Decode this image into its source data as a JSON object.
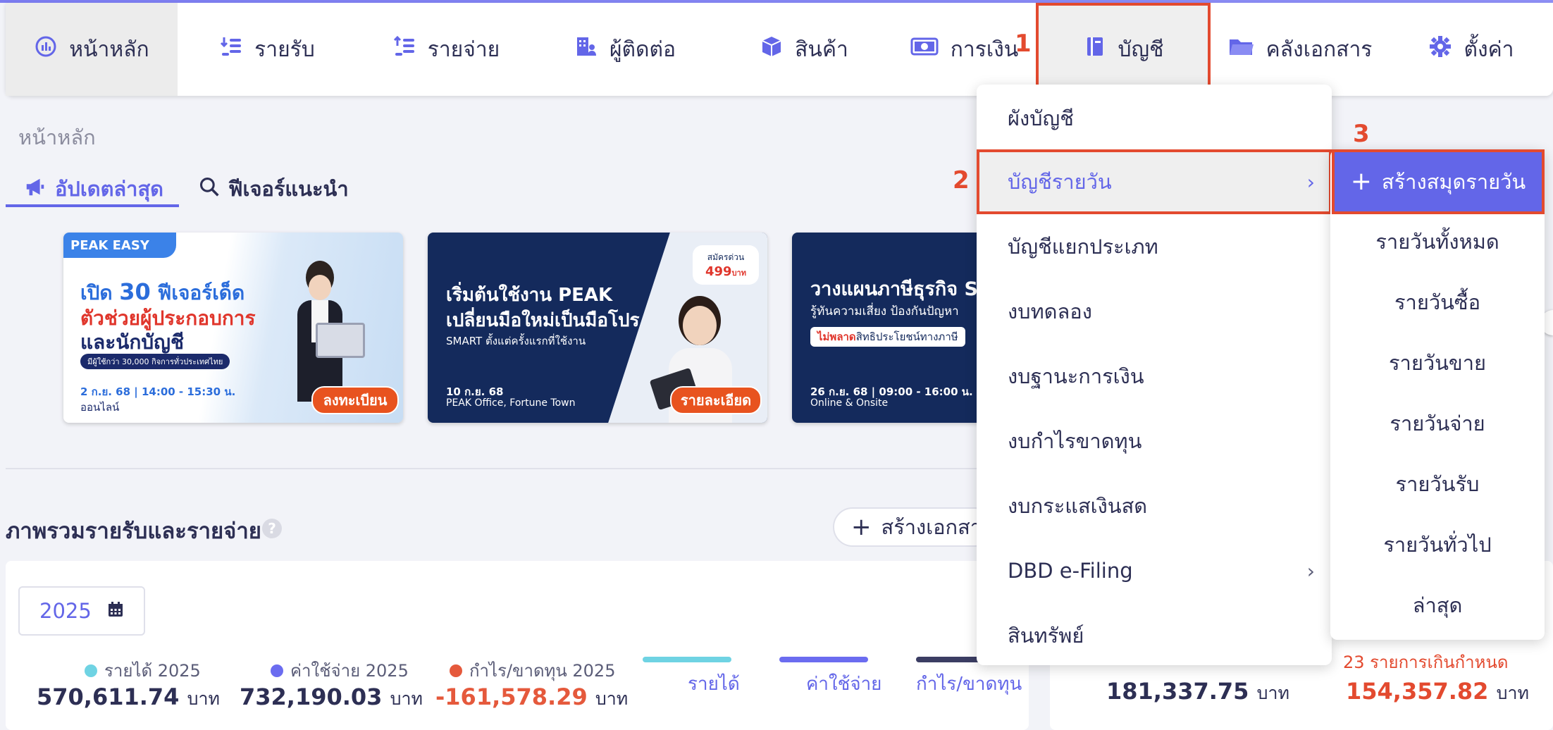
{
  "nav": {
    "items": [
      {
        "label": "หน้าหลัก",
        "icon": "dashboard-icon"
      },
      {
        "label": "รายรับ",
        "icon": "income-icon"
      },
      {
        "label": "รายจ่าย",
        "icon": "expense-icon"
      },
      {
        "label": "ผู้ติดต่อ",
        "icon": "contacts-icon"
      },
      {
        "label": "สินค้า",
        "icon": "box-icon"
      },
      {
        "label": "การเงิน",
        "icon": "money-icon"
      },
      {
        "label": "บัญชี",
        "icon": "ledger-icon"
      },
      {
        "label": "คลังเอกสาร",
        "icon": "folder-icon"
      },
      {
        "label": "ตั้งค่า",
        "icon": "gear-icon"
      }
    ]
  },
  "steps": {
    "one": "1",
    "two": "2",
    "three": "3"
  },
  "page": {
    "breadcrumb": "หน้าหลัก",
    "tabs": {
      "updates": "อัปเดตล่าสุด",
      "features": "ฟีเจอร์แนะนำ"
    }
  },
  "banners": [
    {
      "tag": "PEAK EASY",
      "line1_prefix": "เปิด ",
      "line1_num": "30",
      "line1_suffix": " ฟีเจอร์เด็ด",
      "line2": "ตัวช่วยผู้ประกอบการ",
      "line3": "และนักบัญชี",
      "pill": "มีผู้ใช้กว่า 30,000 กิจการทั่วประเทศไทย",
      "date": "2 ก.ย. 68 | 14:00 - 15:30 น.",
      "place": "ออนไลน์",
      "cta": "ลงทะเบียน"
    },
    {
      "title1": "เริ่มต้นใช้งาน PEAK",
      "title2": "เปลี่ยนมือใหม่เป็นมือโปร",
      "subtitle": "SMART ตั้งแต่ครั้งแรกที่ใช้งาน",
      "badge_top": "สมัครด่วน",
      "badge_price": "499",
      "badge_unit": "บาท",
      "date": "10 ก.ย. 68",
      "place": "PEAK Office, Fortune Town",
      "cta": "รายละเอียด"
    },
    {
      "title1": "วางแผนภาษีธุรกิจ S",
      "subtitle": "รู้ทันความเสี่ยง ป้องกันปัญหา",
      "pill_red": "ไม่พลาด",
      "pill_rest": "สิทธิประโยชน์ทางภาษี",
      "date": "26 ก.ย. 68 | 09:00 - 16:00 น.",
      "place": "Online & Onsite"
    }
  ],
  "overview": {
    "title": "ภาพรวมรายรับและรายจ่าย",
    "help": "?",
    "create_doc": "สร้างเอกสาร",
    "year": "2025",
    "stats": [
      {
        "label": "รายได้ 2025",
        "value": "570,611.74",
        "unit": "บาท",
        "color": "#6fd3e3"
      },
      {
        "label": "ค่าใช้จ่าย 2025",
        "value": "732,190.03",
        "unit": "บาท",
        "color": "#6b6cf0"
      },
      {
        "label": "กำไร/ขาดทุน 2025",
        "value": "-161,578.29",
        "unit": "บาท",
        "color": "#e5593c"
      }
    ],
    "legend": [
      {
        "label": "รายได้",
        "color": "#6fd3e3"
      },
      {
        "label": "ค่าใช้จ่าย",
        "color": "#6b6cf0"
      },
      {
        "label": "กำไร/ขาดทุน",
        "color": "#3b3d63"
      }
    ],
    "side": {
      "overdue_label": "23 รายการเกินกำหนด",
      "left_value": "181,337.75",
      "right_value": "154,357.82",
      "unit": "บาท"
    }
  },
  "accounting_menu": {
    "items": [
      "ผังบัญชี",
      "บัญชีรายวัน",
      "บัญชีแยกประเภท",
      "งบทดลอง",
      "งบฐานะการเงิน",
      "งบกำไรขาดทุน",
      "งบกระแสเงินสด",
      "DBD e-Filing",
      "สินทรัพย์"
    ],
    "chevron": "›"
  },
  "journal_submenu": {
    "create": "สร้างสมุดรายวัน",
    "items": [
      "รายวันทั้งหมด",
      "รายวันซื้อ",
      "รายวันขาย",
      "รายวันจ่าย",
      "รายวันรับ",
      "รายวันทั่วไป",
      "ล่าสุด"
    ]
  },
  "colors": {
    "accent": "#6366e8",
    "highlight": "#e34a2f",
    "navy": "#142a5c"
  }
}
